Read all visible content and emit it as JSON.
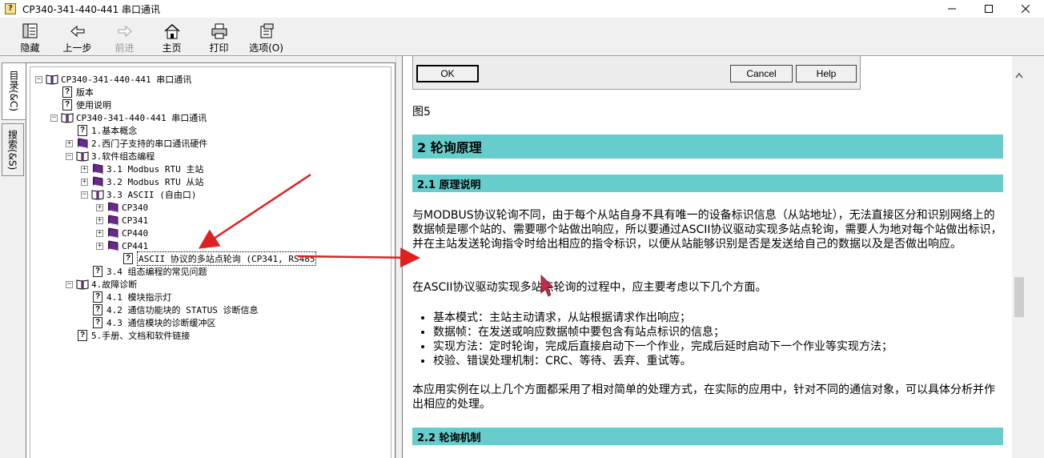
{
  "window": {
    "title": "CP340-341-440-441 串口通讯",
    "app_icon_glyph": "?"
  },
  "toolbar": {
    "hide": "隐藏",
    "back": "上一步",
    "forward": "前进",
    "home": "主页",
    "print": "打印",
    "options": "选项(O)"
  },
  "tabs": {
    "contents": "目录(&C)",
    "search": "搜索(&S)"
  },
  "tree": {
    "nodes": [
      {
        "label": "CP340-341-440-441 串口通讯",
        "icon": "book-open-icon",
        "expander": "−"
      },
      {
        "label": "版本",
        "icon": "help-page-icon"
      },
      {
        "label": "使用说明",
        "icon": "help-page-icon"
      },
      {
        "label": "CP340-341-440-441 串口通讯",
        "icon": "book-open-icon",
        "expander": "−"
      },
      {
        "label": "1.基本概念",
        "icon": "help-page-icon"
      },
      {
        "label": "2.西门子支持的串口通讯硬件",
        "icon": "book-closed-icon",
        "expander": "+"
      },
      {
        "label": "3.软件组态编程",
        "icon": "book-open-icon",
        "expander": "−"
      },
      {
        "label": "3.1 Modbus RTU 主站",
        "icon": "book-closed-icon",
        "expander": "+"
      },
      {
        "label": "3.2 Modbus RTU 从站",
        "icon": "book-closed-icon",
        "expander": "+"
      },
      {
        "label": "3.3 ASCII (自由口)",
        "icon": "book-open-icon",
        "expander": "−"
      },
      {
        "label": "CP340",
        "icon": "book-closed-icon",
        "expander": "+"
      },
      {
        "label": "CP341",
        "icon": "book-closed-icon",
        "expander": "+"
      },
      {
        "label": "CP440",
        "icon": "book-closed-icon",
        "expander": "+"
      },
      {
        "label": "CP441",
        "icon": "book-closed-icon",
        "expander": "+"
      },
      {
        "label": "ASCII 协议的多站点轮询 (CP341, RS485",
        "icon": "help-page-icon"
      },
      {
        "label": "3.4 组态编程的常见问题",
        "icon": "help-page-icon"
      },
      {
        "label": "4.故障诊断",
        "icon": "book-open-icon",
        "expander": "−"
      },
      {
        "label": "4.1 模块指示灯",
        "icon": "help-page-icon"
      },
      {
        "label": "4.2 通信功能块的 STATUS 诊断信息",
        "icon": "help-page-icon"
      },
      {
        "label": "4.3 通信模块的诊断缓冲区",
        "icon": "help-page-icon"
      },
      {
        "label": "5.手册、文档和软件链接",
        "icon": "help-page-icon"
      }
    ]
  },
  "content": {
    "dialog": {
      "ok": "OK",
      "cancel": "Cancel",
      "help": "Help"
    },
    "figure_caption": "图5",
    "h2": "2 轮询原理",
    "h3_1": "2.1 原理说明",
    "para1": "与MODBUS协议轮询不同，由于每个从站自身不具有唯一的设备标识信息（从站地址），无法直接区分和识别网络上的数据帧是哪个站的、需要哪个站做出响应，所以要通过ASCII协议驱动实现多站点轮询，需要人为地对每个站做出标识，并在主站发送轮询指令时给出相应的指令标识，以便从站能够识别是否是发送给自己的数据以及是否做出响应。",
    "para2": "在ASCII协议驱动实现多站点轮询的过程中，应主要考虑以下几个方面。",
    "bullets": [
      "基本模式：主站主动请求，从站根据请求作出响应；",
      "数据帧：在发送或响应数据帧中要包含有站点标识的信息；",
      "实现方法：定时轮询，完成后直接启动下一个作业，完成后延时启动下一个作业等实现方法；",
      "校验、错误处理机制：CRC、等待、丢弃、重试等。"
    ],
    "para3": "本应用实例在以上几个方面都采用了相对简单的处理方式，在实际的应用中，针对不同的通信对象，可以具体分析并作出相应的处理。",
    "h3_2": "2.2 轮询机制"
  },
  "colors": {
    "heading_bar": "#66cccc",
    "annotation_arrow": "#e02020",
    "book_purple": "#6a2a8a"
  }
}
